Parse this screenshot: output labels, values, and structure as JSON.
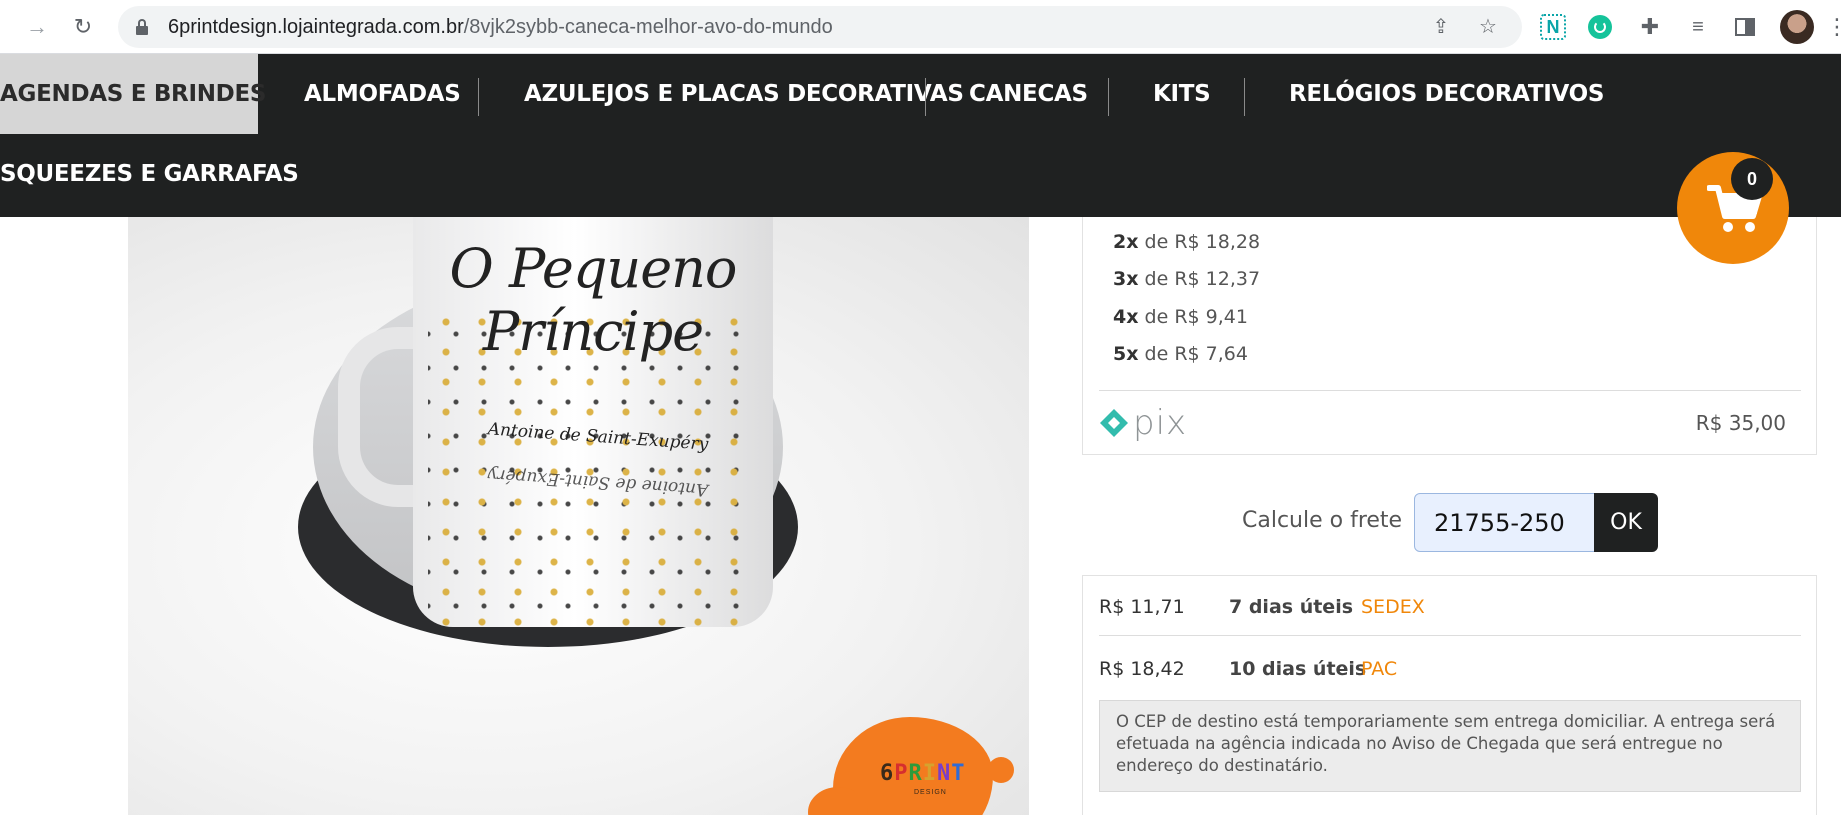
{
  "browser": {
    "url_host": "6printdesign.lojaintegrada.com.br",
    "url_path": "/8vjk2sybb-caneca-melhor-avo-do-mundo",
    "icons": [
      "forward-icon",
      "reload-icon",
      "lock-icon",
      "share-icon",
      "star-icon",
      "extension-n-icon",
      "grammarly-icon",
      "puzzle-icon",
      "media-icon",
      "side-panel-icon",
      "profile-avatar",
      "menu-icon"
    ]
  },
  "nav": {
    "categories": [
      {
        "label": "AGENDAS E BRINDES",
        "active": true
      },
      {
        "label": "ALMOFADAS"
      },
      {
        "label": "AZULEJOS E PLACAS DECORATIVAS"
      },
      {
        "label": "CANECAS"
      },
      {
        "label": "KITS"
      },
      {
        "label": "RELÓGIOS DECORATIVOS"
      },
      {
        "label": "SQUEEZES E GARRAFAS"
      }
    ]
  },
  "cart": {
    "count": "0"
  },
  "product_image": {
    "mug_text": "O Pequeno Príncipe",
    "mug_subtext": "Antoine de Saint-Exupéry",
    "logo_letters": [
      "6",
      "P",
      "R",
      "I",
      "N",
      "T"
    ],
    "logo_small": "DESIGN"
  },
  "installments": [
    {
      "qty": "2x",
      "text": "de R$ 18,28"
    },
    {
      "qty": "3x",
      "text": "de R$ 12,37"
    },
    {
      "qty": "4x",
      "text": "de R$ 9,41"
    },
    {
      "qty": "5x",
      "text": "de R$ 7,64"
    }
  ],
  "pix": {
    "label": "pix",
    "price": "R$ 35,00"
  },
  "shipping": {
    "label": "Calcule o frete",
    "cep_value": "21755-250",
    "button_label": "OK",
    "options": [
      {
        "price": "R$ 11,71",
        "days": "7 dias úteis",
        "name": "SEDEX"
      },
      {
        "price": "R$ 18,42",
        "days": "10 dias úteis",
        "name": "PAC"
      }
    ],
    "notice": "O CEP de destino está temporariamente sem entrega domiciliar. A entrega será efetuada na agência indicada no Aviso de Chegada que será entregue no endereço do destinatário."
  },
  "colors": {
    "nav_bg": "#1f2121",
    "accent_orange": "#f0870a",
    "active_tab_bg": "#d6d6d6"
  }
}
